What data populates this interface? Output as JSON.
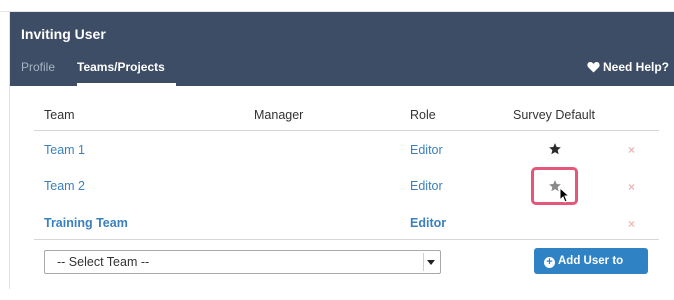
{
  "header": {
    "title": "Inviting User",
    "tabs": [
      {
        "label": "Profile",
        "active": false
      },
      {
        "label": "Teams/Projects",
        "active": true
      }
    ],
    "help_label": "Need Help?"
  },
  "table": {
    "columns": [
      "Team",
      "Manager",
      "Role",
      "Survey Default"
    ],
    "rows": [
      {
        "team": "Team 1",
        "manager": "",
        "role": "Editor",
        "survey_default": "filled-star-icon",
        "remove": "×"
      },
      {
        "team": "Team 2",
        "manager": "",
        "role": "Editor",
        "survey_default": "star-icon",
        "remove": "×"
      },
      {
        "team": "Training Team",
        "manager": "",
        "role": "Editor",
        "survey_default": "",
        "remove": "×"
      }
    ]
  },
  "footer": {
    "select_label": "-- Select Team --",
    "add_button_label": "Add User to Team"
  },
  "colors": {
    "header_bg": "#3d4d65",
    "link": "#3a80c0",
    "button": "#2f82c4",
    "highlight": "#e5577a",
    "remove": "#f0b7b7"
  }
}
